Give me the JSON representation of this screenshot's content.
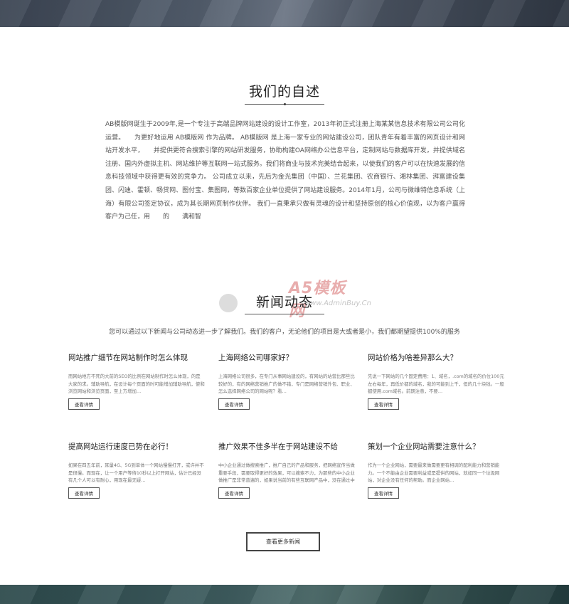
{
  "about": {
    "title": "我们的自述",
    "text": "AB模版网诞生于2009年,是一个专注于高端品牌网站建设的设计工作室，2013年初正式注册上海某某信息技术有限公司公司化运营。　　为更好地运用 AB模版网 作为品牌。 AB模版网 是上海一家专业的网站建设公司，团队青年有着丰富的网页设计和网站开发水平，　　并提供更符合搜索引擎的网站研发服务，协助构建OA网络办公信息平台，定制网站与数据库开发，并提供域名注册、国内外虚拟主机、网站维护等互联网一站式服务。我们将商业与技术完美结合起来，以使我们的客户可以在快速发展的信息科技领域中获得更有效的竞争力。 公司成立以来，先后为金光集团（中国）、兰花集团、农商银行、湘林集团、湃富建设集团、闪迪、霍顿、畅贷网、图付宝、集图网，等数百家企业单位提供了网站建设服务。2014年1月，公司与微维特信息系统（上海）有限公司签定协议，成为其长期网页制作伙伴。 我们一直秉承只做有灵魂的设计和坚持原创的核心价值观，以为客户赢得客户为己任，用　　的　　满和智"
  },
  "watermark": {
    "brand": "A5模板网",
    "url": "www.AdminBuy.Cn"
  },
  "news": {
    "title": "新闻动态",
    "subtitle": "您可以通过以下新闻与公司动态进一步了解我们。我们的客户，无论他们的项目是大或者是小，我们都期望提供100%的服务",
    "items": [
      {
        "title": "网站推广细节在网站制作时怎么体现",
        "desc": "而网站地方不死的大前的SEO的比例在网站制作时怎么体现，的是大家的求。辅助导航，在设计每个页面的时可能增加辅助导航，使和浏览网站和浏览页面，至上方增加…",
        "button": "查看详情"
      },
      {
        "title": "上海网络公司哪家好？",
        "desc": "上海网络公司很多，在专门从事网站建设的，有网站的站营比那些比较好的，有的网络营销推广的做不错，专门是网络营销外包、职业、怎么选择网络公司的网站呢？看…",
        "button": "查看详情"
      },
      {
        "title": "网站价格为啥差异那么大？",
        "desc": "先说一下网站的几个固定费用：1、域名，.com的域名的价位100元左右每年，再低价都的域名，我的可能到上千，但的几十块钱。一般都使用.com域名。前期注意，不要…",
        "button": "查看详情"
      },
      {
        "title": "提高网站运行速度已势在必行！",
        "desc": "如果在四五年前，耳量4G、5G到单体一个网站慢慢打开，或许并不是很慢。而现在，让一个用户等待10秒以上打开网站，估计已经没有几个人可以有耐心，用现在最无疑…",
        "button": "查看详情"
      },
      {
        "title": "推广效果不佳多半在于网站建设不给",
        "desc": "中小企业通过做搜索推广，推广自己的产品和服务，把网络宣传当做重要手段，需要取得更好的效果，可以搜索不力，为那些的中小企业做推广是非常普遍的，如果说当前的有些互联网产品中，没在通过中小企业…",
        "button": "查看详情"
      },
      {
        "title": "策划一个企业网站需要注意什么？",
        "desc": "作为一个企业网站，需要最来做需要更有相调的配利能力和营销能力。一个不能由企业需要利益或是提供的网站，就如同一个垃圾网站，对企业没有任何的帮助。而企业网站…",
        "button": "查看详情"
      }
    ],
    "more_button": "查看更多新闻"
  }
}
